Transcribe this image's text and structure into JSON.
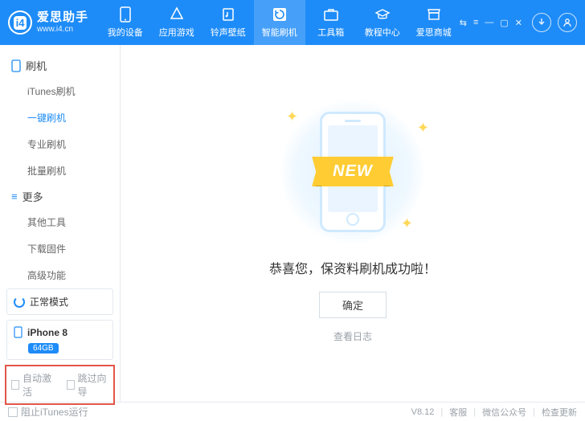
{
  "header": {
    "logo": {
      "cn": "爱思助手",
      "url": "www.i4.cn",
      "badge": "i4"
    },
    "tabs": [
      {
        "key": "device",
        "label": "我的设备"
      },
      {
        "key": "apps",
        "label": "应用游戏"
      },
      {
        "key": "ring",
        "label": "铃声壁纸"
      },
      {
        "key": "flash",
        "label": "智能刷机"
      },
      {
        "key": "toolbox",
        "label": "工具箱"
      },
      {
        "key": "tutorial",
        "label": "教程中心"
      },
      {
        "key": "mall",
        "label": "爱思商城"
      }
    ],
    "active_tab": "flash"
  },
  "sidebar": {
    "section1_title": "刷机",
    "section1_items": [
      "iTunes刷机",
      "一键刷机",
      "专业刷机",
      "批量刷机"
    ],
    "section1_active_index": 1,
    "section2_title": "更多",
    "section2_items": [
      "其他工具",
      "下载固件",
      "高级功能"
    ],
    "mode_label": "正常模式",
    "device_name": "iPhone 8",
    "device_capacity": "64GB",
    "checkbox_auto_activate": "自动激活",
    "checkbox_skip_guide": "跳过向导"
  },
  "main": {
    "ribbon_text": "NEW",
    "success_message": "恭喜您，保资料刷机成功啦！",
    "ok_button": "确定",
    "view_log": "查看日志"
  },
  "footer": {
    "block_itunes": "阻止iTunes运行",
    "version": "V8.12",
    "support": "客服",
    "wechat": "微信公众号",
    "update": "检查更新"
  }
}
